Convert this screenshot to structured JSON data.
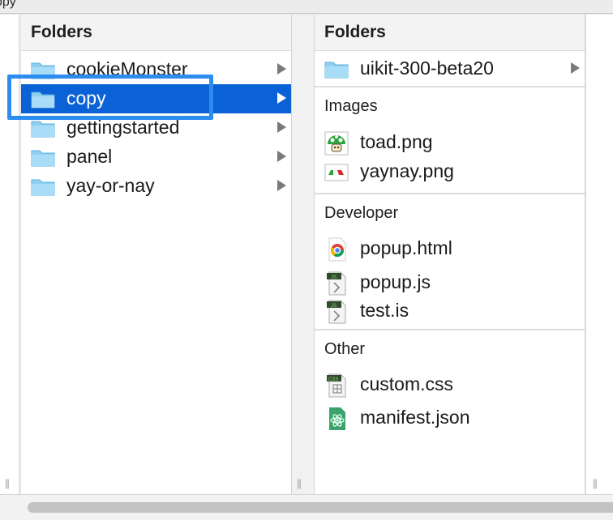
{
  "window": {
    "title": "copy"
  },
  "column1": {
    "header": "Folders",
    "items": [
      {
        "label": "cookieMonster",
        "icon": "folder-icon"
      },
      {
        "label": "copy",
        "icon": "folder-icon",
        "selected": true
      },
      {
        "label": "gettingstarted",
        "icon": "folder-icon"
      },
      {
        "label": "panel",
        "icon": "folder-icon"
      },
      {
        "label": "yay-or-nay",
        "icon": "folder-icon"
      }
    ]
  },
  "column2": {
    "header": "Folders",
    "folders": [
      {
        "label": "uikit-300-beta20",
        "icon": "folder-icon"
      }
    ],
    "sections": [
      {
        "title": "Images",
        "files": [
          {
            "label": "toad.png",
            "icon": "toad-image-icon"
          },
          {
            "label": "yaynay.png",
            "icon": "thumbs-image-icon"
          }
        ]
      },
      {
        "title": "Developer",
        "files": [
          {
            "label": "popup.html",
            "icon": "chrome-html-icon"
          },
          {
            "label": "popup.js",
            "icon": "js-file-icon"
          },
          {
            "label": "test.is",
            "icon": "js-file-icon"
          }
        ]
      },
      {
        "title": "Other",
        "files": [
          {
            "label": "custom.css",
            "icon": "css-file-icon"
          },
          {
            "label": "manifest.json",
            "icon": "atom-json-icon"
          }
        ]
      }
    ]
  },
  "colors": {
    "selection": "#0a62d6",
    "highlight_outline": "#2c8cf0",
    "folder": "#8fd0f2"
  }
}
